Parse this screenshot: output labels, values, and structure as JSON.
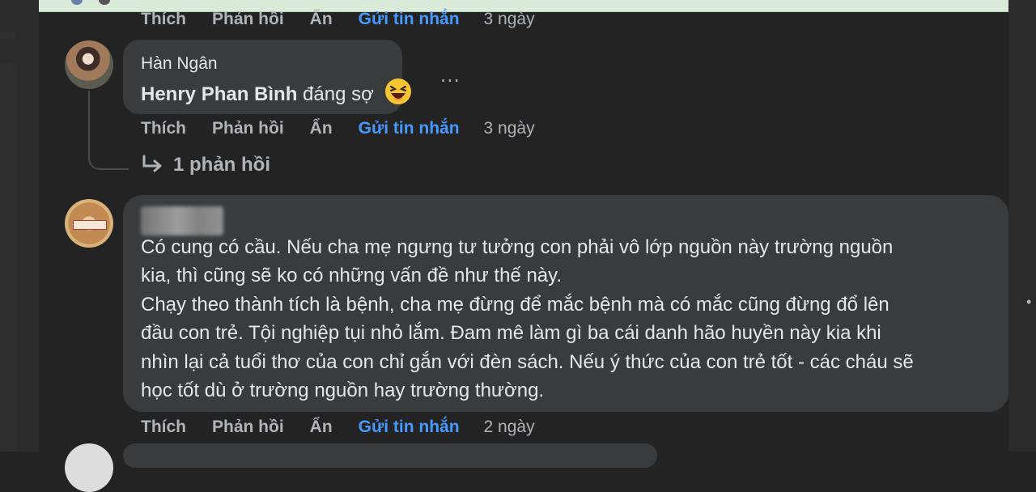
{
  "colors": {
    "background": "#232323",
    "bubble": "#3a3b3c",
    "text": "#e4e6eb",
    "muted": "#b0b3b8",
    "link": "#4599ff"
  },
  "actions_top": {
    "like": "Thích",
    "reply": "Phản hồi",
    "hide": "Ẩn",
    "send": "Gửi tin nhắn",
    "time": "3 ngày"
  },
  "comment1": {
    "author": "Hàn Ngân",
    "tag": "Henry Phan Bình",
    "text": "đáng sợ",
    "emoji": "laughing-face-icon",
    "actions": {
      "like": "Thích",
      "reply": "Phản hồi",
      "hide": "Ẩn",
      "send": "Gửi tin nhắn",
      "time": "3 ngày"
    },
    "replies": "1 phản hồi"
  },
  "comment2": {
    "lines": [
      "Có cung có cầu. Nếu cha mẹ ngưng tư tưởng con phải vô lớp nguồn này trường nguồn",
      "kia, thì cũng sẽ ko có những vấn đề như thế này.",
      "Chạy theo thành tích là bệnh, cha mẹ đừng để mắc bệnh mà có mắc cũng đừng đổ lên",
      "đầu con trẻ. Tội nghiệp tụi nhỏ lắm. Đam mê làm gì ba cái danh hão huyền này kia khi",
      "nhìn lại cả tuổi thơ của con chỉ gắn với đèn sách. Nếu ý thức của con trẻ tốt - các cháu sẽ",
      "học tốt dù ở trường nguồn hay trường thường."
    ],
    "actions": {
      "like": "Thích",
      "reply": "Phản hồi",
      "hide": "Ẩn",
      "send": "Gửi tin nhắn",
      "time": "2 ngày"
    }
  },
  "more_options": "..."
}
